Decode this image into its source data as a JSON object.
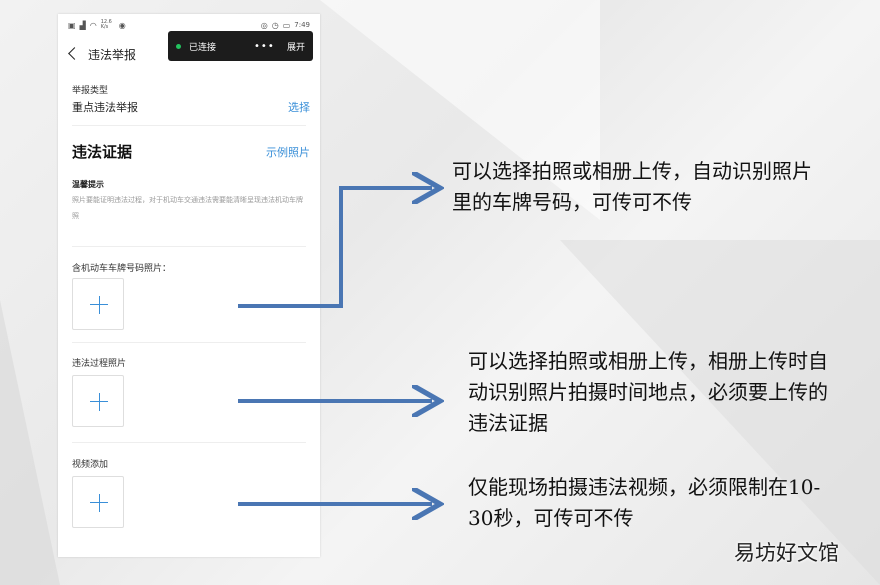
{
  "status_bar": {
    "left_icons": [
      "sim-icon",
      "signal-icon",
      "wifi-icon",
      "hotspot-icon"
    ],
    "speed": "12.6 K/s",
    "right_icons": [
      "nfc-icon",
      "alarm-icon",
      "battery-icon"
    ],
    "time": "7:49"
  },
  "toast": {
    "status": "已连接",
    "more": "•••",
    "expand_label": "展开"
  },
  "nav": {
    "title": "违法举报"
  },
  "report_type": {
    "label": "举报类型",
    "value": "重点违法举报",
    "select_label": "选择"
  },
  "evidence": {
    "heading": "违法证据",
    "example_link": "示例照片",
    "tip_title": "温馨提示",
    "tip_text": "照片要能证明违法过程，对于机动车交通违法需要能清晰呈现违法机动车牌照",
    "uploads": [
      {
        "label": "含机动车车牌号码照片："
      },
      {
        "label": "违法过程照片"
      },
      {
        "label": "视频添加"
      }
    ]
  },
  "annotations": [
    {
      "text": "可以选择拍照或相册上传，自动识别照片里的车牌号码，可传可不传"
    },
    {
      "text": "可以选择拍照或相册上传，相册上传时自动识别照片拍摄时间地点，必须要上传的违法证据"
    },
    {
      "text": "仅能现场拍摄违法视频，必须限制在10-30秒，可传可不传"
    }
  ],
  "watermark": "易坊好文馆",
  "colors": {
    "accent": "#3a8fd8",
    "arrow": "#4a76b3",
    "toast_bg": "#1c1c1c",
    "connected_dot": "#23c35f"
  }
}
